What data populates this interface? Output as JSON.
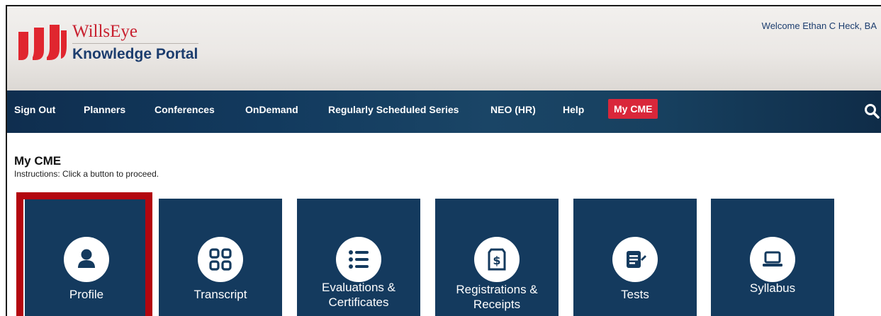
{
  "header": {
    "brand_name": "WillsEye",
    "brand_sub": "Knowledge Portal",
    "welcome": "Welcome Ethan C Heck, BA",
    "colors": {
      "brand_red": "#c8202f",
      "brand_navy": "#1c3d6e"
    }
  },
  "nav": {
    "items": [
      {
        "label": "Sign Out"
      },
      {
        "label": "Planners"
      },
      {
        "label": "Conferences"
      },
      {
        "label": "OnDemand"
      },
      {
        "label": "Regularly Scheduled Series"
      },
      {
        "label": "NEO (HR)"
      },
      {
        "label": "Help"
      },
      {
        "label": "My CME",
        "active": true
      }
    ],
    "search_icon": "search-icon",
    "active_color": "#d9273a"
  },
  "main": {
    "title": "My CME",
    "instructions": "Instructions: Click a button to proceed.",
    "tiles": [
      {
        "label": "Profile",
        "icon": "user-icon",
        "selected": true
      },
      {
        "label": "Transcript",
        "icon": "grid-icon"
      },
      {
        "label": "Evaluations & Certificates",
        "icon": "list-icon"
      },
      {
        "label": "Registrations & Receipts",
        "icon": "receipt-dollar-icon"
      },
      {
        "label": "Tests",
        "icon": "document-edit-icon"
      },
      {
        "label": "Syllabus",
        "icon": "laptop-icon"
      }
    ],
    "tile_color": "#143a5e",
    "highlight_color": "#b3060f"
  }
}
